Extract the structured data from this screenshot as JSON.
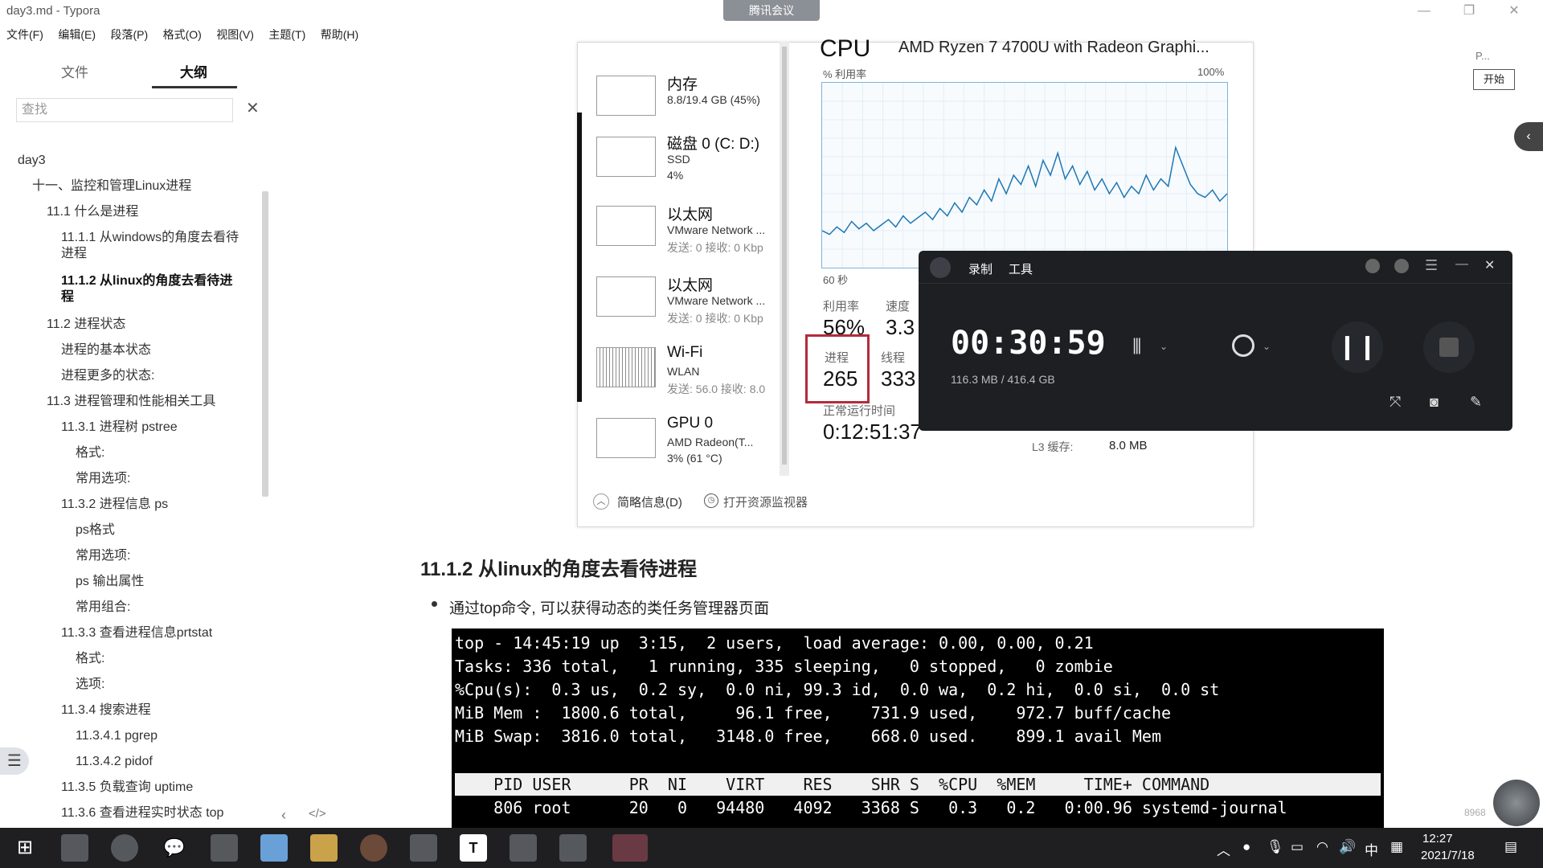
{
  "window": {
    "title": "day3.md - Typora",
    "meeting_label": "腾讯会议",
    "minimize": "—",
    "maximize": "❐",
    "close": "✕"
  },
  "menubar": [
    "文件(F)",
    "编辑(E)",
    "段落(P)",
    "格式(O)",
    "视图(V)",
    "主题(T)",
    "帮助(H)"
  ],
  "sidebar": {
    "tab_files": "文件",
    "tab_outline": "大纲",
    "search_placeholder": "查找",
    "search_clear": "✕",
    "toc": [
      {
        "text": "day3",
        "level": 0
      },
      {
        "text": "十一、监控和管理Linux进程",
        "level": 1
      },
      {
        "text": "11.1 什么是进程",
        "level": 2
      },
      {
        "text": "11.1.1 从windows的角度去看待进程",
        "level": 3
      },
      {
        "text": "11.1.2 从linux的角度去看待进程",
        "level": 3,
        "active": true
      },
      {
        "text": "11.2 进程状态",
        "level": 2
      },
      {
        "text": "进程的基本状态",
        "level": 3
      },
      {
        "text": "进程更多的状态:",
        "level": 3
      },
      {
        "text": "11.3 进程管理和性能相关工具",
        "level": 2
      },
      {
        "text": "11.3.1 进程树 pstree",
        "level": 3
      },
      {
        "text": "格式:",
        "level": 4
      },
      {
        "text": "常用选项:",
        "level": 4
      },
      {
        "text": "11.3.2 进程信息 ps",
        "level": 3
      },
      {
        "text": "ps格式",
        "level": 4
      },
      {
        "text": "常用选项:",
        "level": 4
      },
      {
        "text": "ps 输出属性",
        "level": 4
      },
      {
        "text": "常用组合:",
        "level": 4
      },
      {
        "text": "11.3.3 查看进程信息prtstat",
        "level": 3
      },
      {
        "text": "格式:",
        "level": 4
      },
      {
        "text": "选项:",
        "level": 4
      },
      {
        "text": "11.3.4 搜索进程",
        "level": 3
      },
      {
        "text": "11.3.4.1 pgrep",
        "level": 4
      },
      {
        "text": "11.3.4.2 pidof",
        "level": 4
      },
      {
        "text": "11.3.5 负载查询 uptime",
        "level": 3
      },
      {
        "text": "11.3.6 查看进程实时状态 top",
        "level": 3
      }
    ],
    "bottom_left": "‹",
    "bottom_code": "</>"
  },
  "taskmgr": {
    "resources": [
      {
        "title": "内存",
        "sub": "8.8/19.4 GB (45%)",
        "sub2": ""
      },
      {
        "title": "磁盘 0 (C: D:)",
        "sub": "SSD",
        "sub2": "4%"
      },
      {
        "title": "以太网",
        "sub": "VMware Network ...",
        "sub2": "发送: 0 接收: 0 Kbp"
      },
      {
        "title": "以太网",
        "sub": "VMware Network ...",
        "sub2": "发送: 0 接收: 0 Kbp"
      },
      {
        "title": "Wi-Fi",
        "sub": "WLAN",
        "sub2": "发送: 56.0 接收: 8.0"
      },
      {
        "title": "GPU 0",
        "sub": "AMD Radeon(T...",
        "sub2": "3% (61 °C)"
      }
    ],
    "cpu_label": "CPU",
    "cpu_model": "AMD Ryzen 7 4700U with Radeon Graphi...",
    "util_label": "% 利用率",
    "pct_100": "100%",
    "seconds_label": "60 秒",
    "cpu_history": [
      20,
      18,
      22,
      19,
      25,
      21,
      24,
      20,
      23,
      26,
      22,
      28,
      24,
      27,
      30,
      26,
      32,
      28,
      35,
      30,
      38,
      34,
      42,
      36,
      48,
      40,
      50,
      45,
      55,
      44,
      58,
      50,
      62,
      48,
      55,
      45,
      52,
      42,
      48,
      40,
      46,
      38,
      44,
      40,
      50,
      42,
      48,
      44,
      65,
      55,
      45,
      40,
      38,
      42,
      36,
      40
    ],
    "stats": {
      "util_lbl": "利用率",
      "util_val": "56%",
      "speed_lbl": "速度",
      "speed_val": "3.3",
      "proc_lbl": "进程",
      "proc_val": "265",
      "thread_lbl": "线程",
      "thread_val": "333",
      "uptime_lbl": "正常运行时间",
      "uptime_val": "0:12:51:37",
      "l3_lbl": "L3 缓存:",
      "l3_val": "8.0 MB"
    },
    "footer_summary": "简略信息(D)",
    "footer_monitor": "打开资源监视器"
  },
  "recorder": {
    "tab_record": "录制",
    "tab_tools": "工具",
    "timer": "00:30:59",
    "storage": "116.3 MB / 416.4 GB",
    "min": "—",
    "close": "✕"
  },
  "document": {
    "heading": "11.1.2 从linux的角度去看待进程",
    "bullet": "通过top命令, 可以获得动态的类任务管理器页面",
    "terminal_lines": [
      "top - 14:45:19 up  3:15,  2 users,  load average: 0.00, 0.00, 0.21",
      "Tasks: 336 total,   1 running, 335 sleeping,   0 stopped,   0 zombie",
      "%Cpu(s):  0.3 us,  0.2 sy,  0.0 ni, 99.3 id,  0.0 wa,  0.2 hi,  0.0 si,  0.0 st",
      "MiB Mem :  1800.6 total,     96.1 free,    731.9 used,    972.7 buff/cache",
      "MiB Swap:  3816.0 total,   3148.0 free,    668.0 used.    899.1 avail Mem"
    ],
    "terminal_header": "    PID USER      PR  NI    VIRT    RES    SHR S  %CPU  %MEM     TIME+ COMMAND",
    "terminal_row": "    806 root      20   0   94480   4092   3368 S   0.3   0.2   0:00.96 systemd-journal"
  },
  "right": {
    "p_label": "P...",
    "start_label": "开始",
    "collapse": "‹",
    "status_number": "8968"
  },
  "taskbar": {
    "time": "12:27",
    "date": "2021/7/18",
    "ime": "中",
    "t_icon": "T"
  },
  "colors": {
    "accent_red": "#b22c3c",
    "graph_line": "#1f77b4",
    "taskbar_bg": "#1f1f22"
  }
}
